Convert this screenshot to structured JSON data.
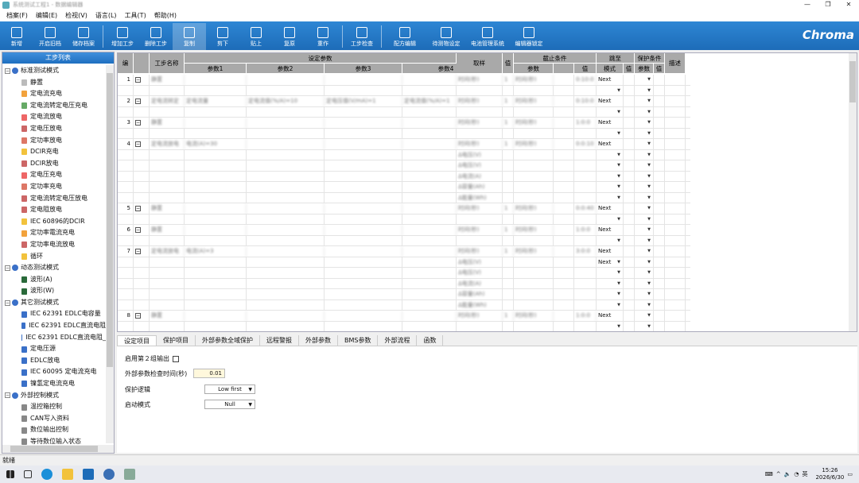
{
  "window": {
    "title": "系统测试工程1 - 数据编辑器",
    "controls": [
      "—",
      "❐",
      "✕"
    ]
  },
  "menu": [
    "档案(F)",
    "编辑(E)",
    "检视(V)",
    "语言(L)",
    "工具(T)",
    "帮助(H)"
  ],
  "ribbon": {
    "buttons": [
      "新增",
      "开启旧档",
      "储存档案",
      "增加工步",
      "删除工步",
      "复制",
      "剪下",
      "贴上",
      "复原",
      "重作",
      "工步检查",
      "配方编辑",
      "待测物设定",
      "电池管理系统",
      "编辑器锁定"
    ],
    "active": "复制",
    "brand": "Chroma"
  },
  "left_panel": {
    "title": "工步列表",
    "groups": [
      {
        "label": "标准测试模式",
        "items": [
          "静置",
          "定电流充电",
          "定电流转定电压充电",
          "定电流放电",
          "定电压放电",
          "定功率放电",
          "DCIR充电",
          "DCIR放电",
          "定电压充电",
          "定功率充电",
          "定电流转定电压放电",
          "定电阻放电",
          "IEC 60896的DCIR",
          "定功率電流充电",
          "定功率电流放电",
          "循环"
        ]
      },
      {
        "label": "动态测试模式",
        "items": [
          "波形(A)",
          "波形(W)"
        ]
      },
      {
        "label": "其它测试模式",
        "items": [
          "IEC 62391 EDLC电容量",
          "IEC 62391 EDLC直流电阻",
          "IEC 62391 EDLC直流电阻_",
          "定电压源",
          "EDLC放电",
          "IEC 60095 定电流充电",
          "镍氢定电流充电"
        ]
      },
      {
        "label": "外部控制模式",
        "items": [
          "温控箱控制",
          "CAN写入资料",
          "数位输出控制",
          "等待数位输入状态"
        ]
      }
    ]
  },
  "grid": {
    "headers": {
      "no": "编",
      "name": "工步名称",
      "params": "设定参数",
      "param_cols": [
        "参数1",
        "参数2",
        "参数3",
        "参数4"
      ],
      "sample": "取样",
      "val": "值",
      "cutoff": "截止条件",
      "cutoff_param": "参数",
      "cutoff_val": "值",
      "jump": "跳至",
      "mode": "模式",
      "jump_val": "值",
      "protect": "保护条件",
      "protect_param": "参数",
      "protect_val": "值",
      "desc": "描述"
    },
    "steps": [
      {
        "no": "1",
        "name": "静置",
        "p1": "",
        "p2": "",
        "p3": "",
        "p4": "",
        "sample": "时间(秒)",
        "sv": "1",
        "cutoff": "时间(秒)",
        "cv": "0:10:0",
        "jump": "Next",
        "extra_rows": 1
      },
      {
        "no": "2",
        "name": "定电流转定",
        "p1": "定电流量",
        "p2": "定电流值(%/A)=10",
        "p3": "定电压值(V/mA)=1",
        "p4": "定电流值(%/A)=1",
        "sample": "时间(秒)",
        "sv": "1",
        "cutoff": "时间(秒)",
        "cv": "0:10:0",
        "jump": "Next",
        "extra_rows": 1
      },
      {
        "no": "3",
        "name": "静置",
        "p1": "",
        "p2": "",
        "p3": "",
        "p4": "",
        "sample": "时间(秒)",
        "sv": "1",
        "cutoff": "时间(秒)",
        "cv": "1:0:0",
        "jump": "Next",
        "extra_rows": 1
      },
      {
        "no": "4",
        "name": "定电流放电",
        "p1": "电流(A)=30",
        "p2": "",
        "p3": "",
        "p4": "",
        "sample": "时间(秒)",
        "sv": "1",
        "cutoff": "时间(秒)",
        "cv": "0:0:10",
        "jump": "Next",
        "extra_rows": 5
      },
      {
        "no": "5",
        "name": "静置",
        "p1": "",
        "p2": "",
        "p3": "",
        "p4": "",
        "sample": "时间(秒)",
        "sv": "1",
        "cutoff": "时间(秒)",
        "cv": "0:0:40",
        "jump": "Next",
        "extra_rows": 1
      },
      {
        "no": "6",
        "name": "静置",
        "p1": "",
        "p2": "",
        "p3": "",
        "p4": "",
        "sample": "时间(秒)",
        "sv": "1",
        "cutoff": "时间(秒)",
        "cv": "1:0:0",
        "jump": "Next",
        "extra_rows": 1
      },
      {
        "no": "7",
        "name": "定电流放电",
        "p1": "电流(A)=3",
        "p2": "",
        "p3": "",
        "p4": "",
        "sample": "时间(秒)",
        "sv": "1",
        "cutoff": "时间(秒)",
        "cv": "3:0:0",
        "jump": "Next",
        "jump2": "Next",
        "extra_rows": 5
      },
      {
        "no": "8",
        "name": "静置",
        "p1": "",
        "p2": "",
        "p3": "",
        "p4": "",
        "sample": "时间(秒)",
        "sv": "1",
        "cutoff": "时间(秒)",
        "cv": "1:0:0",
        "jump": "Next",
        "extra_rows": 1
      }
    ],
    "sub_sample": [
      "Δ电压(V)",
      "Δ电压(V)",
      "Δ电流(A)",
      "Δ容量(Ah)",
      "Δ能量(Wh)"
    ]
  },
  "tabs": [
    "设定项目",
    "保护项目",
    "外部参数全域保护",
    "远程警报",
    "外部参数",
    "BMS参数",
    "外部流程",
    "函数"
  ],
  "tabs_selected": "设定项目",
  "settings": {
    "dual_output_label": "启用第２组输出",
    "ext_check_label": "外部参数检查时间(秒)",
    "ext_check_value": "0.01",
    "protect_logic_label": "保护逻辑",
    "protect_logic_value": "Low first",
    "start_mode_label": "启动模式",
    "start_mode_value": "Null"
  },
  "status": "就绪",
  "taskbar": {
    "time": "15:26",
    "date": "2026/6/30",
    "ime": "英"
  },
  "colors": {
    "ribbon": "#1d6cb8",
    "header": "#a9a9a9",
    "accent": "#3f8fdc"
  }
}
